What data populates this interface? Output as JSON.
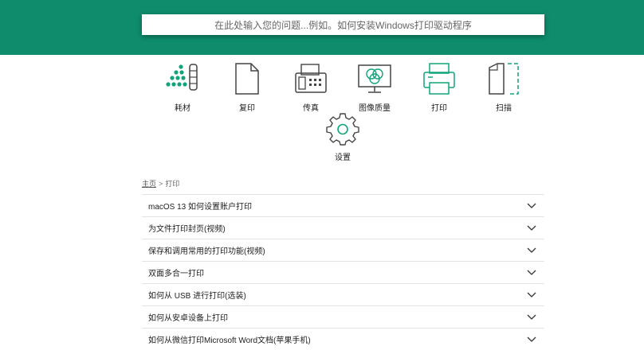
{
  "search": {
    "placeholder": "在此处输入您的问题...例如。如何安装Windows打印驱动程序"
  },
  "categories": [
    {
      "label": "耗材",
      "icon": "toner-dots-icon"
    },
    {
      "label": "复印",
      "icon": "document-icon"
    },
    {
      "label": "传真",
      "icon": "fax-icon"
    },
    {
      "label": "图像质量",
      "icon": "monitor-color-icon"
    },
    {
      "label": "打印",
      "icon": "printer-icon"
    },
    {
      "label": "扫描",
      "icon": "scan-icon"
    },
    {
      "label": "设置",
      "icon": "gear-icon"
    }
  ],
  "breadcrumb": {
    "home": "主页",
    "separator": ">",
    "current": "打印"
  },
  "faq": [
    "macOS 13 如何设置账户打印",
    "为文件打印封页(视频)",
    "保存和调用常用的打印功能(视频)",
    "双面多合一打印",
    "如何从 USB 进行打印(选装)",
    "如何从安卓设备上打印",
    "如何从微信打印Microsoft Word文档(苹果手机)"
  ],
  "colors": {
    "brand": "#0e8c6c",
    "accent": "#12a37a"
  }
}
